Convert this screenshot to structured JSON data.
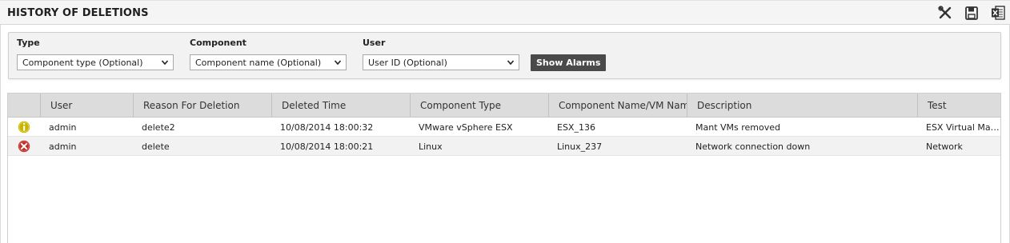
{
  "header": {
    "title": "HISTORY OF DELETIONS",
    "icons": [
      "tools-icon",
      "save-icon",
      "excel-export-icon"
    ]
  },
  "filters": {
    "type_label": "Type",
    "type_value": "Component type (Optional)",
    "component_label": "Component",
    "component_value": "Component name (Optional)",
    "user_label": "User",
    "user_value": "User ID (Optional)",
    "show_button": "Show Alarms"
  },
  "table": {
    "columns": [
      "",
      "User",
      "Reason For Deletion",
      "Deleted Time",
      "Component Type",
      "Component Name/VM Name",
      "Description",
      "Test"
    ],
    "rows": [
      {
        "status": "info-icon",
        "status_color": "#c8b400",
        "user": "admin",
        "reason": "delete2",
        "time": "10/08/2014 18:00:32",
        "ctype": "VMware vSphere ESX",
        "cname": "ESX_136",
        "desc": "Mant VMs removed",
        "test": "ESX Virtual Machine"
      },
      {
        "status": "error-icon",
        "status_color": "#c0302a",
        "user": "admin",
        "reason": "delete",
        "time": "10/08/2014 18:00:21",
        "ctype": "Linux",
        "cname": "Linux_237",
        "desc": "Network connection down",
        "test": "Network"
      }
    ]
  },
  "colors": {
    "button_bg": "#4a4a4a",
    "header_bg": "#dcdcdc",
    "alt_row_bg": "#f2f2f2"
  }
}
